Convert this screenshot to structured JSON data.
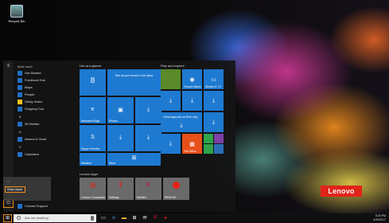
{
  "desktop": {
    "recycle_bin_label": "Recycle Bin",
    "brand_logo_text": "Lenovo"
  },
  "start_menu": {
    "most_used_label": "Most used",
    "most_used": [
      {
        "label": "Get Started",
        "icon": "lightbulb-icon"
      },
      {
        "label": "Feedback Hub",
        "icon": "feedback-icon"
      },
      {
        "label": "Maps",
        "icon": "map-icon"
      },
      {
        "label": "People",
        "icon": "people-icon"
      },
      {
        "label": "Sticky Notes",
        "icon": "note-icon"
      },
      {
        "label": "Snipping Tool",
        "icon": "scissors-icon"
      }
    ],
    "letters": [
      "#",
      "A",
      "C"
    ],
    "apps_hash": [
      {
        "label": "3D Builder",
        "icon": "cube-icon"
      }
    ],
    "apps_a": [
      {
        "label": "Alarms & Clock",
        "icon": "clock-icon"
      }
    ],
    "apps_c": [
      {
        "label": "Calculator",
        "icon": "calculator-icon"
      }
    ],
    "apps_bottom": [
      {
        "label": "Contact Support",
        "icon": "support-icon"
      }
    ],
    "highlighted_text": "Shut down"
  },
  "groups": {
    "life_label": "Life at a glance",
    "play_label": "Play and explore",
    "lenovo_label": "Lenovo Apps"
  },
  "tiles": {
    "calendar_day": "8",
    "calendar_label": "See all your email in one place",
    "edge_label": "Microsoft Edge",
    "photos_label": "Photos",
    "skype_label": "Skype Preview",
    "weather_label": "Weather",
    "store_label": "Store",
    "groove_label": "Groove Music",
    "movies_label": "Movies & TV",
    "onenote_label": "OneNote",
    "get_office_label": "Get Office",
    "placeholder_label": "Great apps are on their way",
    "lenovo_app1": "Lenovo Companion",
    "lenovo_app2": "Settings",
    "lenovo_app3": "McAfee",
    "lenovo_app4": "REACHit"
  },
  "taskbar": {
    "search_placeholder": "Ask me anything",
    "time": "5:34 PM",
    "date": "4/20/2017"
  },
  "colors": {
    "tile_blue": "#1e7ad1",
    "office_red": "#e8501b",
    "highlight_orange": "#f08c1a",
    "lenovo_red": "#e2231a"
  }
}
